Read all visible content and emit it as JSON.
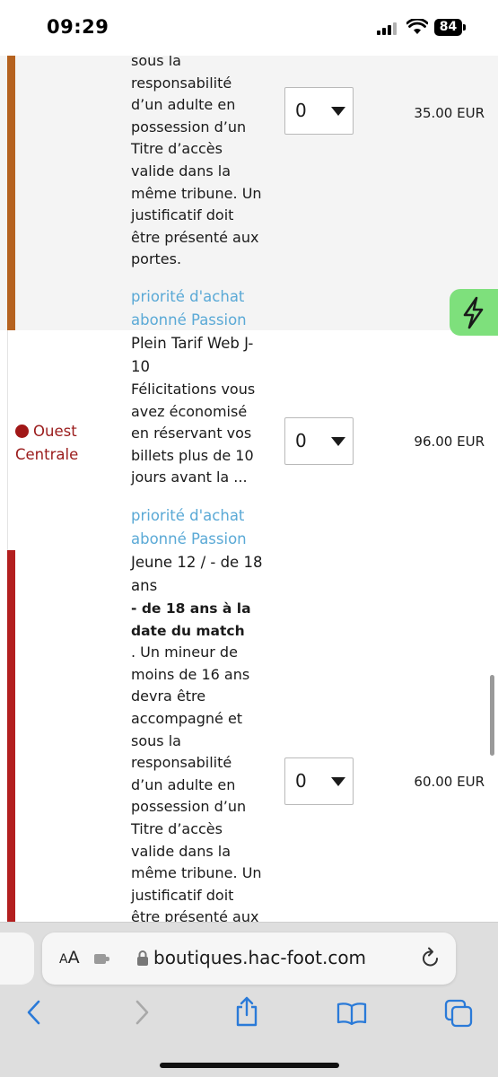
{
  "status_bar": {
    "time": "09:29",
    "battery": "84"
  },
  "tickets": [
    {
      "description_lines": [
        "sous la",
        "responsabilité",
        "d’un adulte en",
        "possession d’un",
        "Titre d’accès",
        "valide dans la",
        "même tribune. Un",
        "justificatif doit",
        "être présenté aux",
        "portes."
      ],
      "quantity": "0",
      "price": "35.00 EUR",
      "promo_lines": [
        "priorité d'achat",
        "abonné Passion"
      ]
    },
    {
      "title_lines": [
        "Plein Tarif Web J-",
        "10"
      ],
      "description_lines": [
        "Félicitations vous",
        "avez économisé",
        "en réservant vos",
        "billets plus de 10",
        "jours avant la ..."
      ],
      "quantity": "0",
      "price": "96.00 EUR",
      "promo_lines": [
        "priorité d'achat",
        "abonné Passion"
      ]
    },
    {
      "title_lines": [
        "Jeune 12 / - de 18",
        "ans"
      ],
      "bold_lines": [
        "- de 18 ans à la",
        "date du match"
      ],
      "description_lines": [
        ". Un mineur de",
        "moins de 16 ans",
        "devra être",
        "accompagné et",
        "sous la",
        "responsabilité",
        "d’un adulte en",
        "possession d’un",
        "Titre d’accès",
        "valide dans la",
        "même tribune. Un",
        "justificatif doit",
        "être présenté aux"
      ],
      "quantity": "0",
      "price": "60.00 EUR"
    }
  ],
  "zone": {
    "lines": [
      "Ouest",
      "Centrale"
    ],
    "color": "#a11818"
  },
  "colors": {
    "bar_1": "#b5621f",
    "bar_3": "#b31f1f",
    "promo": "#5aa9d6",
    "bolt_button": "#7ee07c"
  },
  "browser": {
    "aa_label_big": "A",
    "aa_label_small": "A",
    "url": "boutiques.hac-foot.com"
  }
}
